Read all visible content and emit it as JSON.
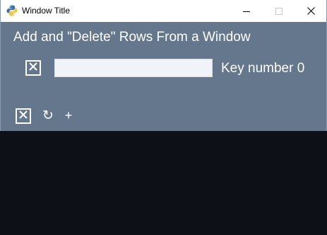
{
  "window": {
    "title": "Window Title",
    "controls": {
      "minimize": "minimize-icon",
      "maximize": "maximize-icon",
      "close": "close-icon"
    }
  },
  "main": {
    "heading": "Add and \"Delete\" Rows From a Window",
    "rows": [
      {
        "delete_icon": "close-box-icon",
        "input_value": "",
        "label": "Key number 0"
      }
    ]
  },
  "footer": {
    "delete_icon": "close-box-icon",
    "refresh_glyph": "↻",
    "add_glyph": "+"
  },
  "colors": {
    "window_bg": "#64778d",
    "titlebar_bg": "#ffffff",
    "desktop_bg": "#0d1117",
    "text": "#ffffff",
    "input_bg": "#f0f3f7"
  }
}
